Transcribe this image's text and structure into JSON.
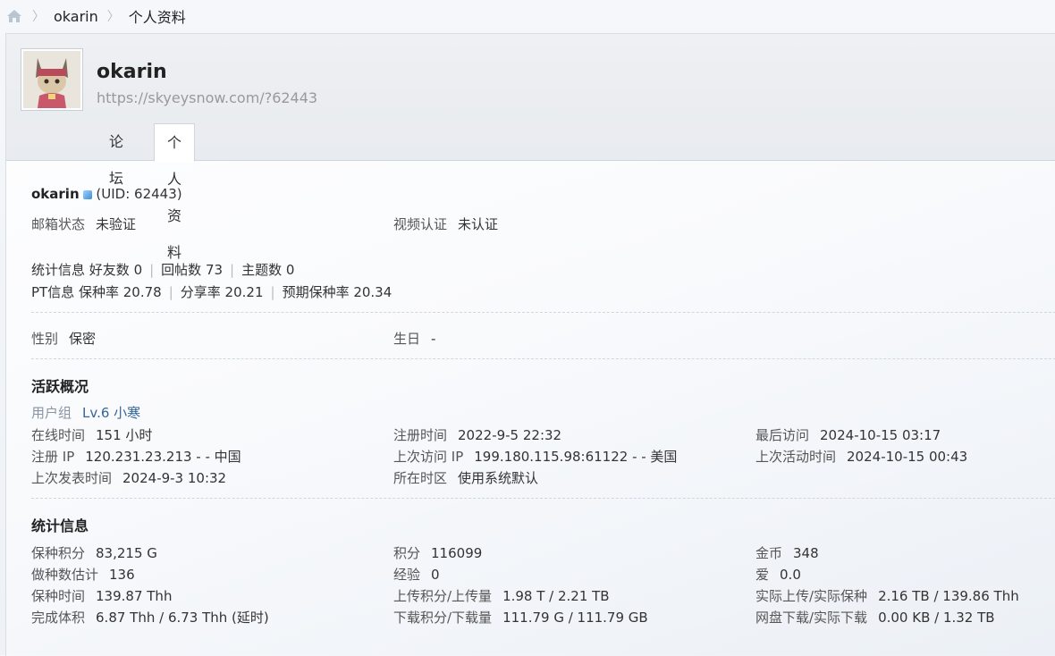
{
  "breadcrumb": {
    "items": [
      "okarin",
      "个人资料"
    ],
    "separator": "〉"
  },
  "profile": {
    "username": "okarin",
    "url": "https://skyeysnow.com/?62443",
    "tabs": [
      {
        "label": "论坛"
      },
      {
        "label": "个人资料"
      }
    ]
  },
  "basic": {
    "name": "okarin",
    "uid": "(UID: 62443)",
    "email_label": "邮箱状态",
    "email_value": "未验证",
    "video_label": "视频认证",
    "video_value": "未认证",
    "stats_prefix": "统计信息",
    "friends": "好友数 0",
    "replies": "回帖数 73",
    "threads": "主题数 0",
    "pt_prefix": "PT信息",
    "seed_rate": "保种率 20.78",
    "share_rate": "分享率 20.21",
    "expected_seed_rate": "预期保种率 20.34",
    "gender_label": "性别",
    "gender_value": "保密",
    "birthday_label": "生日",
    "birthday_value": "-"
  },
  "activity": {
    "title": "活跃概况",
    "group_label": "用户组",
    "group_value": "Lv.6 小寒",
    "online_label": "在线时间",
    "online_value": "151 小时",
    "reg_time_label": "注册时间",
    "reg_time_value": "2022-9-5 22:32",
    "last_visit_label": "最后访问",
    "last_visit_value": "2024-10-15 03:17",
    "reg_ip_label": "注册 IP",
    "reg_ip_value": "120.231.23.213 - - 中国",
    "last_ip_label": "上次访问 IP",
    "last_ip_value": "199.180.115.98:61122 - - 美国",
    "last_active_label": "上次活动时间",
    "last_active_value": "2024-10-15 00:43",
    "last_post_label": "上次发表时间",
    "last_post_value": "2024-9-3 10:32",
    "tz_label": "所在时区",
    "tz_value": "使用系统默认"
  },
  "stats": {
    "title": "统计信息",
    "seed_points_label": "保种积分",
    "seed_points_value": "83,215 G",
    "points_label": "积分",
    "points_value": "116099",
    "coins_label": "金币",
    "coins_value": "348",
    "seed_count_label": "做种数估计",
    "seed_count_value": "136",
    "exp_label": "经验",
    "exp_value": "0",
    "love_label": "爱",
    "love_value": "0.0",
    "seed_time_label": "保种时间",
    "seed_time_value": "139.87 Thh",
    "upload_label": "上传积分/上传量",
    "upload_value": "1.98 T / 2.21 TB",
    "real_upload_label": "实际上传/实际保种",
    "real_upload_value": "2.16 TB / 139.86 Thh",
    "completed_label": "完成体积",
    "completed_value": "6.87 Thh / 6.73 Thh (延时)",
    "download_label": "下载积分/下载量",
    "download_value": "111.79 G / 111.79 GB",
    "netdisk_label": "网盘下载/实际下载",
    "netdisk_value": "0.00 KB / 1.32 TB"
  }
}
